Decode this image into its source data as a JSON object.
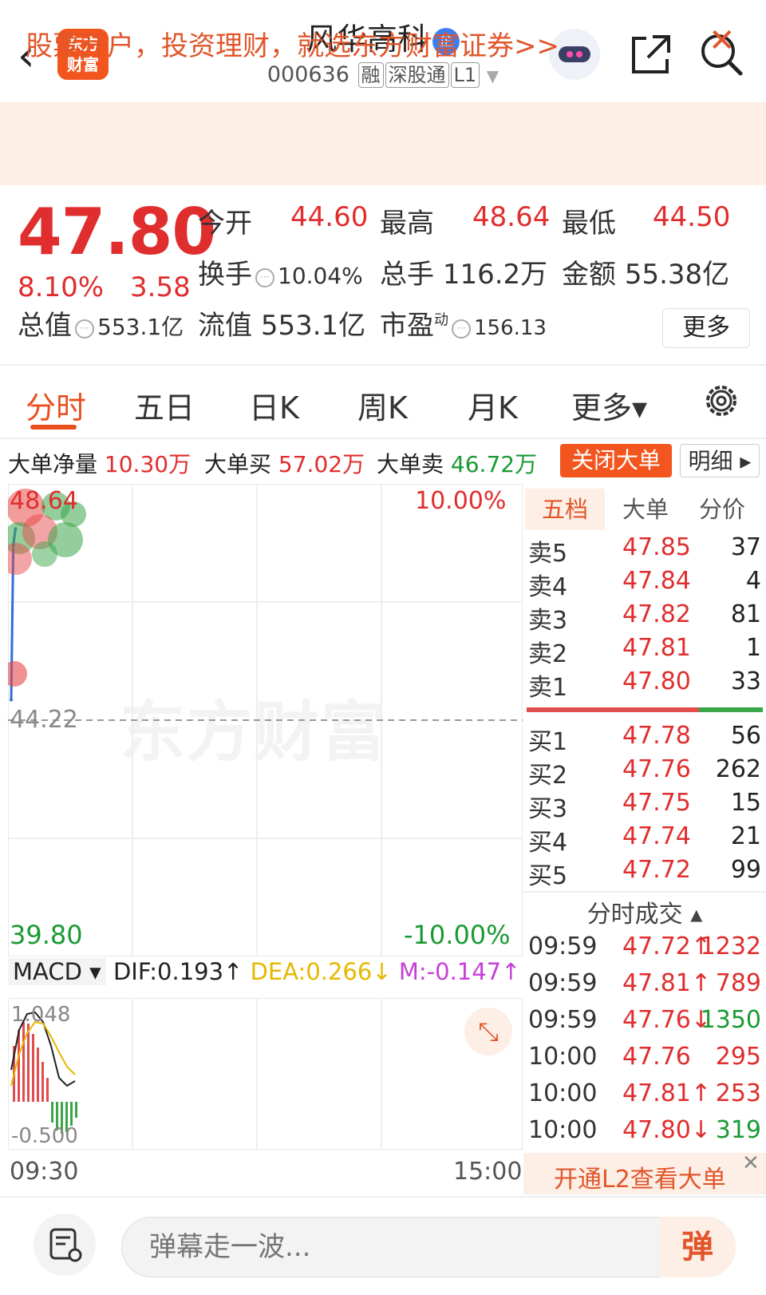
{
  "header": {
    "back_glyph": "‹",
    "logo_text_line1": "东方",
    "logo_text_line2": "财富",
    "stock_name": "风华高科",
    "badge": "企",
    "code": "000636",
    "tags": [
      "融",
      "深股通",
      "L1"
    ],
    "dropdown_glyph": "▼"
  },
  "banner": {
    "text": "股票开户，投资理财，就选东方财富证券>>",
    "close_glyph": "✕"
  },
  "quote": {
    "price": "47.80",
    "change_pct": "8.10%",
    "change": "3.58",
    "open_label": "今开",
    "open_value": "44.60",
    "high_label": "最高",
    "high_value": "48.64",
    "low_label": "最低",
    "low_value": "44.50",
    "turnover_label": "换手",
    "turnover_value": "10.04%",
    "volume_label": "总手",
    "volume_value": "116.2万",
    "amount_label": "金额",
    "amount_value": "55.38亿",
    "mktcap_label": "总值",
    "mktcap_value": "553.1亿",
    "float_label": "流值",
    "float_value": "553.1亿",
    "pe_label": "市盈",
    "pe_sup": "动",
    "pe_value": "156.13",
    "more_label": "更多"
  },
  "tabs": {
    "items": [
      "分时",
      "五日",
      "日K",
      "周K",
      "月K",
      "更多▾"
    ],
    "active_index": 0
  },
  "bigorder": {
    "net_label": "大单净量",
    "net_value": "10.30万",
    "buy_label": "大单买",
    "buy_value": "57.02万",
    "sell_label": "大单卖",
    "sell_value": "46.72万",
    "close_label": "关闭大单",
    "detail_label": "明细 ▸"
  },
  "chart": {
    "watermark": "东方财富",
    "y_high": "48.64",
    "y_mid": "44.22",
    "y_low": "39.80",
    "pct_high": "10.00%",
    "pct_low": "-10.00%",
    "time_start": "09:30",
    "time_end": "15:00",
    "chart_data": {
      "type": "line",
      "title": "",
      "ylim": [
        39.8,
        48.64
      ],
      "prev_close": 44.22,
      "x": [
        "09:30",
        "09:31",
        "09:32"
      ],
      "values": [
        44.6,
        47.5,
        47.8
      ]
    }
  },
  "macd": {
    "selector": "MACD ▾",
    "dif": "DIF:0.193↑",
    "dea": "DEA:0.266↓",
    "m": "M:-0.147↑",
    "y_top": "1.048",
    "y_bottom": "-0.500",
    "expand_glyph": "⤡",
    "colors": {
      "dif": "#222222",
      "dea": "#e6b800",
      "m": "#c63fd8"
    }
  },
  "orderbook": {
    "tabs": [
      "五档",
      "大单",
      "分价"
    ],
    "asks": [
      {
        "label": "卖5",
        "price": "47.85",
        "vol": "37"
      },
      {
        "label": "卖4",
        "price": "47.84",
        "vol": "4"
      },
      {
        "label": "卖3",
        "price": "47.82",
        "vol": "81"
      },
      {
        "label": "卖2",
        "price": "47.81",
        "vol": "1"
      },
      {
        "label": "卖1",
        "price": "47.80",
        "vol": "33"
      }
    ],
    "bids": [
      {
        "label": "买1",
        "price": "47.78",
        "vol": "56"
      },
      {
        "label": "买2",
        "price": "47.76",
        "vol": "262"
      },
      {
        "label": "买3",
        "price": "47.75",
        "vol": "15"
      },
      {
        "label": "买4",
        "price": "47.74",
        "vol": "21"
      },
      {
        "label": "买5",
        "price": "47.72",
        "vol": "99"
      }
    ],
    "buy_ratio": 0.73
  },
  "ticks": {
    "header": "分时成交 ▴",
    "rows": [
      {
        "time": "09:59",
        "price": "47.72↑",
        "vol": "1232",
        "color": "red"
      },
      {
        "time": "09:59",
        "price": "47.81↑",
        "vol": "789",
        "color": "red"
      },
      {
        "time": "09:59",
        "price": "47.76↓",
        "vol": "1350",
        "color": "green"
      },
      {
        "time": "10:00",
        "price": "47.76",
        "vol": "295",
        "color": "red"
      },
      {
        "time": "10:00",
        "price": "47.81↑",
        "vol": "253",
        "color": "red"
      },
      {
        "time": "10:00",
        "price": "47.80↓",
        "vol": "319",
        "color": "green"
      }
    ]
  },
  "l2": {
    "text": "开通L2查看大单",
    "close_glyph": "✕"
  },
  "bottom": {
    "input_placeholder": "弹幕走一波...",
    "danmu_label": "弹"
  }
}
